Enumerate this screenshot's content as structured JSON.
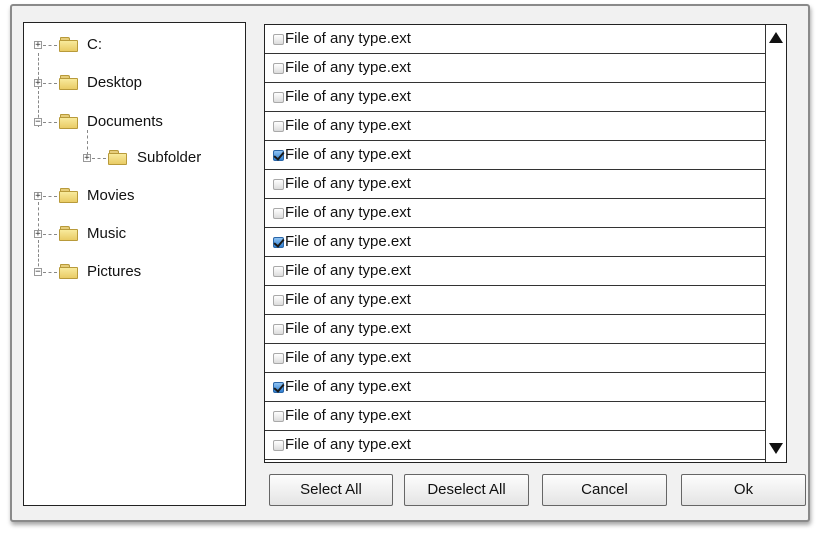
{
  "tree": {
    "nodes": [
      {
        "label": "C:",
        "expander": "+"
      },
      {
        "label": "Desktop",
        "expander": "+"
      },
      {
        "label": "Documents",
        "expander": "−"
      },
      {
        "label": "Subfolder",
        "expander": "+"
      },
      {
        "label": "Movies",
        "expander": "+"
      },
      {
        "label": "Music",
        "expander": "+"
      },
      {
        "label": "Pictures",
        "expander": "−"
      }
    ]
  },
  "files": [
    {
      "name": "File of any type.ext",
      "checked": false
    },
    {
      "name": "File of any type.ext",
      "checked": false
    },
    {
      "name": "File of any type.ext",
      "checked": false
    },
    {
      "name": "File of any type.ext",
      "checked": false
    },
    {
      "name": "File of any type.ext",
      "checked": true
    },
    {
      "name": "File of any type.ext",
      "checked": false
    },
    {
      "name": "File of any type.ext",
      "checked": false
    },
    {
      "name": "File of any type.ext",
      "checked": true
    },
    {
      "name": "File of any type.ext",
      "checked": false
    },
    {
      "name": "File of any type.ext",
      "checked": false
    },
    {
      "name": "File of any type.ext",
      "checked": false
    },
    {
      "name": "File of any type.ext",
      "checked": false
    },
    {
      "name": "File of any type.ext",
      "checked": true
    },
    {
      "name": "File of any type.ext",
      "checked": false
    },
    {
      "name": "File of any type.ext",
      "checked": false
    }
  ],
  "buttons": {
    "select_all": "Select All",
    "deselect_all": "Deselect All",
    "cancel": "Cancel",
    "ok": "Ok"
  },
  "colors": {
    "checkbox_checked": "#2f7fd1",
    "folder": "#f0d97a"
  }
}
